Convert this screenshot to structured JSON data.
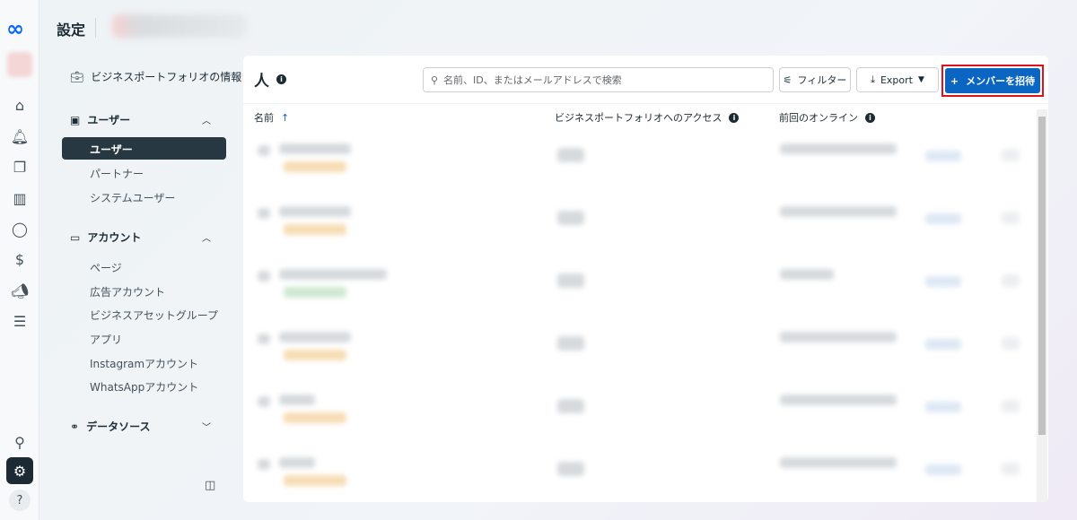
{
  "header": {
    "title": "設定"
  },
  "sidebar": {
    "business_info": "ビジネスポートフォリオの情報",
    "users_section": "ユーザー",
    "users_items": [
      "ユーザー",
      "パートナー",
      "システムユーザー"
    ],
    "accounts_section": "アカウント",
    "accounts_items": [
      "ページ",
      "広告アカウント",
      "ビジネスアセットグループ",
      "アプリ",
      "Instagramアカウント",
      "WhatsAppアカウント"
    ],
    "datasource_section": "データソース"
  },
  "panel": {
    "title": "人",
    "search_placeholder": "名前、ID、またはメールアドレスで検索",
    "filter_label": "フィルター",
    "export_label": "Export",
    "invite_label": "メンバーを招待",
    "columns": [
      "名前",
      "ビジネスポートフォリオへのアクセス",
      "前回のオンライン"
    ],
    "sort_indicator": "↑"
  },
  "colors": {
    "accent": "#0a66c2",
    "highlight": "#e1101a",
    "selected": "#283842"
  }
}
